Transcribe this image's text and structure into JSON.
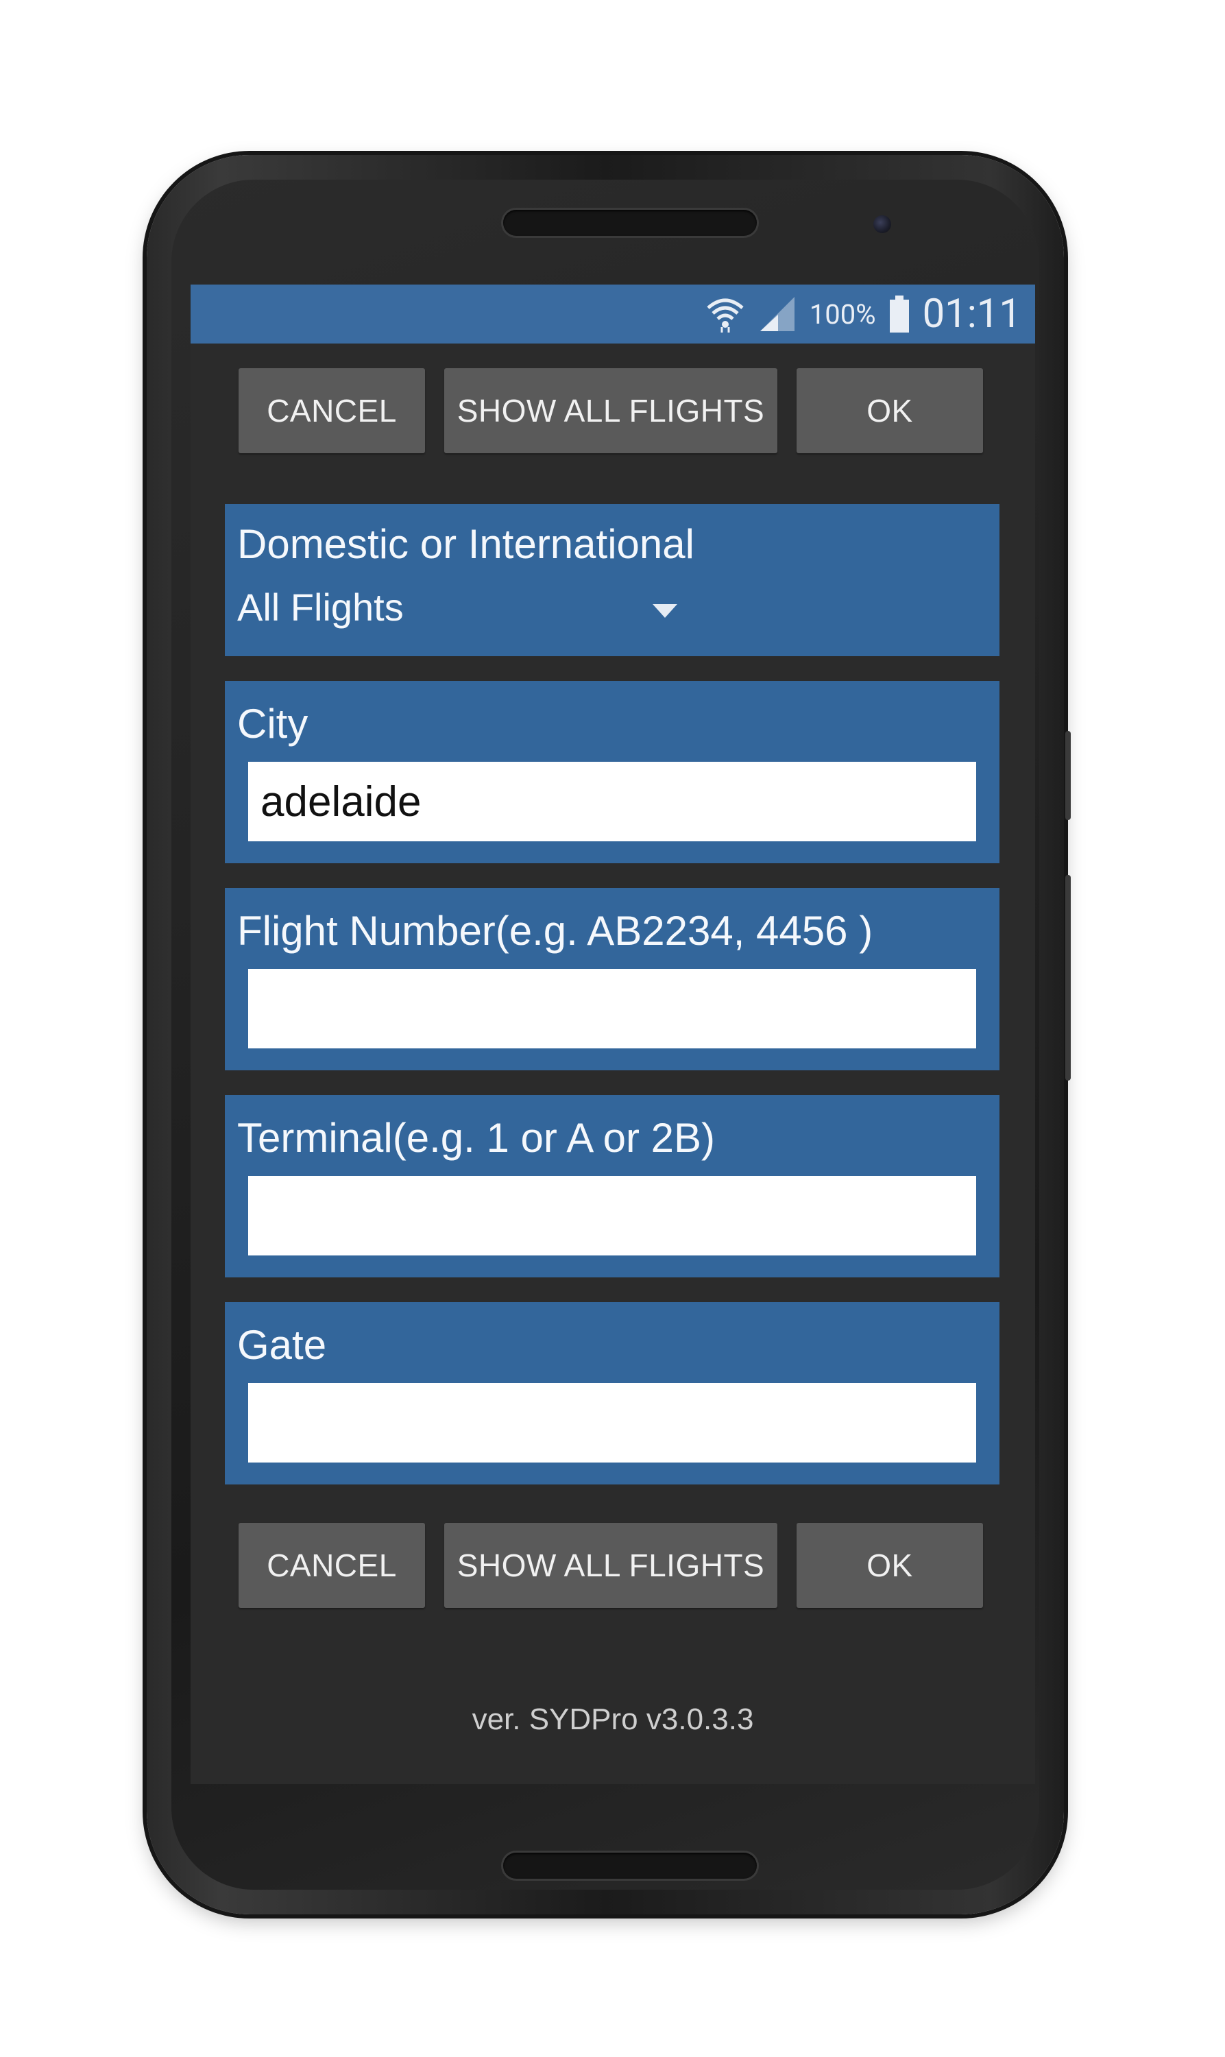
{
  "status_bar": {
    "battery": "100%",
    "time": "01:11",
    "icons": [
      "wifi-icon",
      "signal-icon",
      "battery-icon"
    ]
  },
  "top_buttons": {
    "cancel": "CANCEL",
    "show_all": "SHOW ALL FLIGHTS",
    "ok": "OK"
  },
  "domestic_panel": {
    "label": "Domestic or International",
    "selected": "All Flights"
  },
  "city_panel": {
    "label": "City",
    "value": "adelaide"
  },
  "flight_panel": {
    "label": "Flight Number(e.g. AB2234, 4456 )",
    "value": ""
  },
  "terminal_panel": {
    "label": "Terminal(e.g. 1 or A or 2B)",
    "value": ""
  },
  "gate_panel": {
    "label": "Gate",
    "value": ""
  },
  "bottom_buttons": {
    "cancel": "CANCEL",
    "show_all": "SHOW ALL FLIGHTS",
    "ok": "OK"
  },
  "footer": {
    "version": "ver. SYDPro v3.0.3.3"
  },
  "colors": {
    "status_bar": "#3a6ba0",
    "panel": "#33669b",
    "button": "#5a5a5a",
    "screen_bg": "#2b2b2b"
  }
}
